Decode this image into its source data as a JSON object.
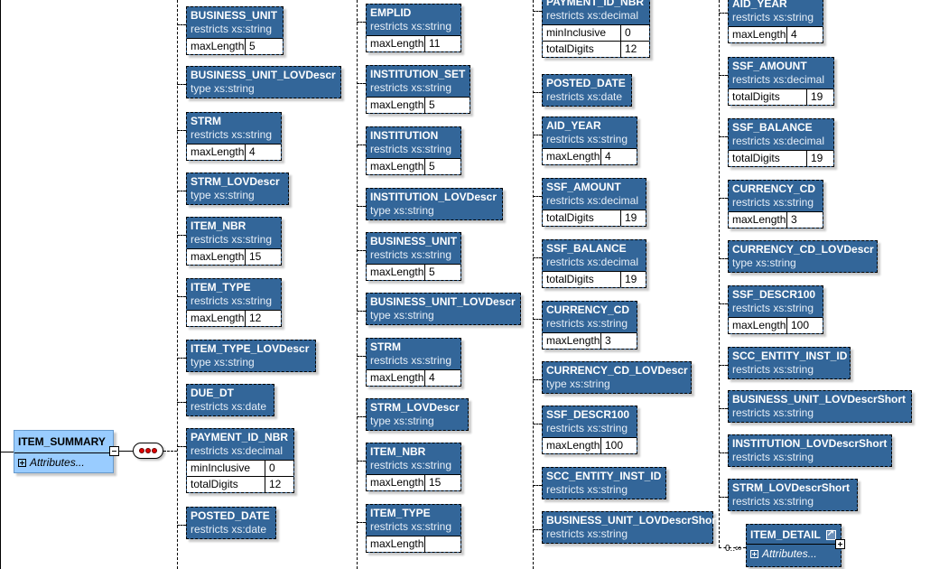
{
  "root": {
    "name": "ITEM_SUMMARY",
    "attributes_label": "Attributes...",
    "icons": {
      "collapse": "minus-box-icon",
      "expand_attributes": "plus-box-icon",
      "sequence": "sequence-compositor-icon"
    }
  },
  "columns": [
    {
      "nodes": [
        {
          "name": "BUSINESS_UNIT",
          "type": "restricts xs:string",
          "facets": [
            {
              "k": "maxLength",
              "v": "5"
            }
          ]
        },
        {
          "name": "BUSINESS_UNIT_LOVDescr",
          "type": "type xs:string",
          "facets": []
        },
        {
          "name": "STRM",
          "type": "restricts xs:string",
          "facets": [
            {
              "k": "maxLength",
              "v": "4"
            }
          ]
        },
        {
          "name": "STRM_LOVDescr",
          "type": "type xs:string",
          "facets": []
        },
        {
          "name": "ITEM_NBR",
          "type": "restricts xs:string",
          "facets": [
            {
              "k": "maxLength",
              "v": "15"
            }
          ]
        },
        {
          "name": "ITEM_TYPE",
          "type": "restricts xs:string",
          "facets": [
            {
              "k": "maxLength",
              "v": "12"
            }
          ]
        },
        {
          "name": "ITEM_TYPE_LOVDescr",
          "type": "type xs:string",
          "facets": []
        },
        {
          "name": "DUE_DT",
          "type": "restricts xs:date",
          "facets": []
        },
        {
          "name": "PAYMENT_ID_NBR",
          "type": "restricts xs:decimal",
          "facets": [
            {
              "k": "minInclusive",
              "v": "0"
            },
            {
              "k": "totalDigits",
              "v": "12"
            }
          ]
        },
        {
          "name": "POSTED_DATE",
          "type": "restricts xs:date",
          "facets": []
        }
      ]
    },
    {
      "nodes": [
        {
          "name": "EMPLID",
          "type": "restricts xs:string",
          "facets": [
            {
              "k": "maxLength",
              "v": "11"
            }
          ]
        },
        {
          "name": "INSTITUTION_SET",
          "type": "restricts xs:string",
          "facets": [
            {
              "k": "maxLength",
              "v": "5"
            }
          ]
        },
        {
          "name": "INSTITUTION",
          "type": "restricts xs:string",
          "facets": [
            {
              "k": "maxLength",
              "v": "5"
            }
          ]
        },
        {
          "name": "INSTITUTION_LOVDescr",
          "type": "type xs:string",
          "facets": []
        },
        {
          "name": "BUSINESS_UNIT",
          "type": "restricts xs:string",
          "facets": [
            {
              "k": "maxLength",
              "v": "5"
            }
          ]
        },
        {
          "name": "BUSINESS_UNIT_LOVDescr",
          "type": "type xs:string",
          "facets": []
        },
        {
          "name": "STRM",
          "type": "restricts xs:string",
          "facets": [
            {
              "k": "maxLength",
              "v": "4"
            }
          ]
        },
        {
          "name": "STRM_LOVDescr",
          "type": "type xs:string",
          "facets": []
        },
        {
          "name": "ITEM_NBR",
          "type": "restricts xs:string",
          "facets": [
            {
              "k": "maxLength",
              "v": "15"
            }
          ]
        },
        {
          "name": "ITEM_TYPE",
          "type": "restricts xs:string",
          "facets": [
            {
              "k": "maxLength",
              "v": ""
            }
          ]
        }
      ]
    },
    {
      "nodes": [
        {
          "name": "PAYMENT_ID_NBR",
          "type": "restricts xs:decimal",
          "facets": [
            {
              "k": "minInclusive",
              "v": "0"
            },
            {
              "k": "totalDigits",
              "v": "12"
            }
          ]
        },
        {
          "name": "POSTED_DATE",
          "type": "restricts xs:date",
          "facets": []
        },
        {
          "name": "AID_YEAR",
          "type": "restricts xs:string",
          "facets": [
            {
              "k": "maxLength",
              "v": "4"
            }
          ]
        },
        {
          "name": "SSF_AMOUNT",
          "type": "restricts xs:decimal",
          "facets": [
            {
              "k": "totalDigits",
              "v": "19"
            }
          ]
        },
        {
          "name": "SSF_BALANCE",
          "type": "restricts xs:decimal",
          "facets": [
            {
              "k": "totalDigits",
              "v": "19"
            }
          ]
        },
        {
          "name": "CURRENCY_CD",
          "type": "restricts xs:string",
          "facets": [
            {
              "k": "maxLength",
              "v": "3"
            }
          ]
        },
        {
          "name": "CURRENCY_CD_LOVDescr",
          "type": "type xs:string",
          "facets": []
        },
        {
          "name": "SSF_DESCR100",
          "type": "restricts xs:string",
          "facets": [
            {
              "k": "maxLength",
              "v": "100"
            }
          ]
        },
        {
          "name": "SCC_ENTITY_INST_ID",
          "type": "restricts xs:string",
          "facets": []
        },
        {
          "name": "BUSINESS_UNIT_LOVDescrShort",
          "type": "restricts xs:string",
          "facets": []
        }
      ]
    },
    {
      "nodes": [
        {
          "name": "AID_YEAR",
          "type": "restricts xs:string",
          "facets": [
            {
              "k": "maxLength",
              "v": "4"
            }
          ]
        },
        {
          "name": "SSF_AMOUNT",
          "type": "restricts xs:decimal",
          "facets": [
            {
              "k": "totalDigits",
              "v": "19"
            }
          ]
        },
        {
          "name": "SSF_BALANCE",
          "type": "restricts xs:decimal",
          "facets": [
            {
              "k": "totalDigits",
              "v": "19"
            }
          ]
        },
        {
          "name": "CURRENCY_CD",
          "type": "restricts xs:string",
          "facets": [
            {
              "k": "maxLength",
              "v": "3"
            }
          ]
        },
        {
          "name": "CURRENCY_CD_LOVDescr",
          "type": "type xs:string",
          "facets": []
        },
        {
          "name": "SSF_DESCR100",
          "type": "restricts xs:string",
          "facets": [
            {
              "k": "maxLength",
              "v": "100"
            }
          ]
        },
        {
          "name": "SCC_ENTITY_INST_ID",
          "type": "restricts xs:string",
          "facets": []
        },
        {
          "name": "BUSINESS_UNIT_LOVDescrShort",
          "type": "restricts xs:string",
          "facets": []
        },
        {
          "name": "INSTITUTION_LOVDescrShort",
          "type": "restricts xs:string",
          "facets": []
        },
        {
          "name": "STRM_LOVDescrShort",
          "type": "restricts xs:string",
          "facets": []
        }
      ]
    }
  ],
  "item_detail": {
    "name": "ITEM_DETAIL",
    "attributes_label": "Attributes...",
    "occurrence": "0..∞"
  }
}
